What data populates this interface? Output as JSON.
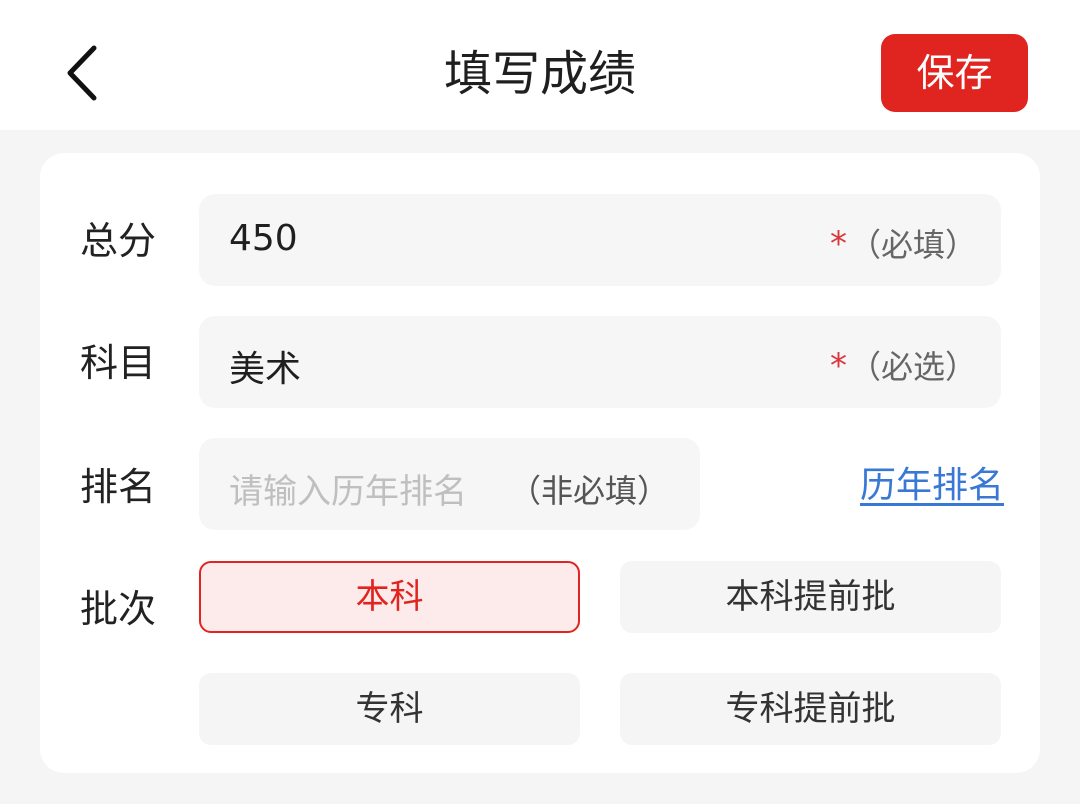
{
  "header": {
    "title": "填写成绩",
    "save_label": "保存",
    "back_icon": "chevron-left-icon"
  },
  "form": {
    "total": {
      "label": "总分",
      "value": "450",
      "required_mark": "*",
      "hint": "（必填）"
    },
    "subject": {
      "label": "科目",
      "value": "美术",
      "required_mark": "*",
      "hint": "（必选）"
    },
    "rank": {
      "label": "排名",
      "placeholder": "请输入历年排名",
      "hint": "（非必填）",
      "link": "历年排名"
    },
    "batch": {
      "label": "批次",
      "options": [
        "本科",
        "本科提前批",
        "专科",
        "专科提前批"
      ],
      "selected": "本科"
    }
  },
  "colors": {
    "accent": "#e0241f",
    "link": "#3a78d6",
    "background": "#f5f5f5"
  }
}
